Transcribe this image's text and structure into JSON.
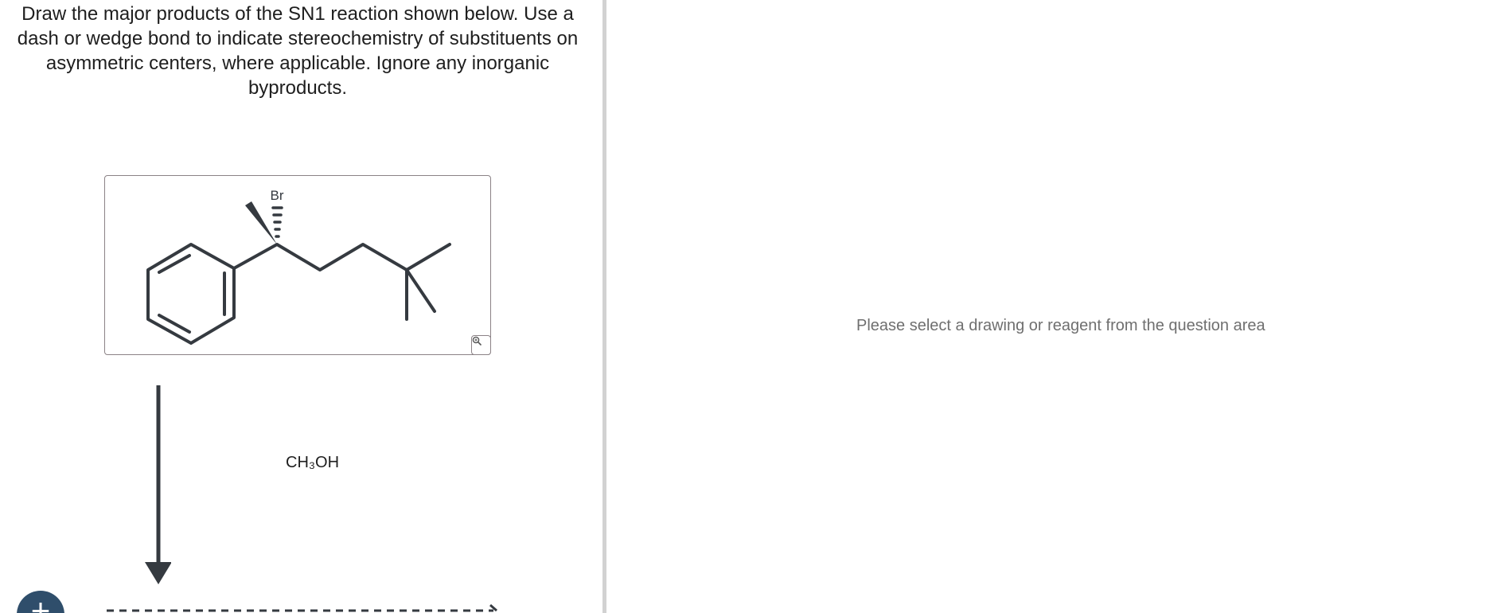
{
  "question": {
    "prompt": "Draw the major products of the SN1 reaction shown below. Use a dash or wedge bond to indicate stereochemistry of substituents on asymmetric centers, where applicable. Ignore any inorganic byproducts."
  },
  "reactant": {
    "atom_label": "Br"
  },
  "reagent": {
    "label": "CH₃OH"
  },
  "add_button": {
    "label": "+"
  },
  "answer_panel": {
    "placeholder": "Please select a drawing or reagent from the question area"
  },
  "colors": {
    "bond": "#353a40",
    "accent": "#2f4e6b",
    "divider": "#d2d2d2",
    "border": "#8b8286"
  }
}
